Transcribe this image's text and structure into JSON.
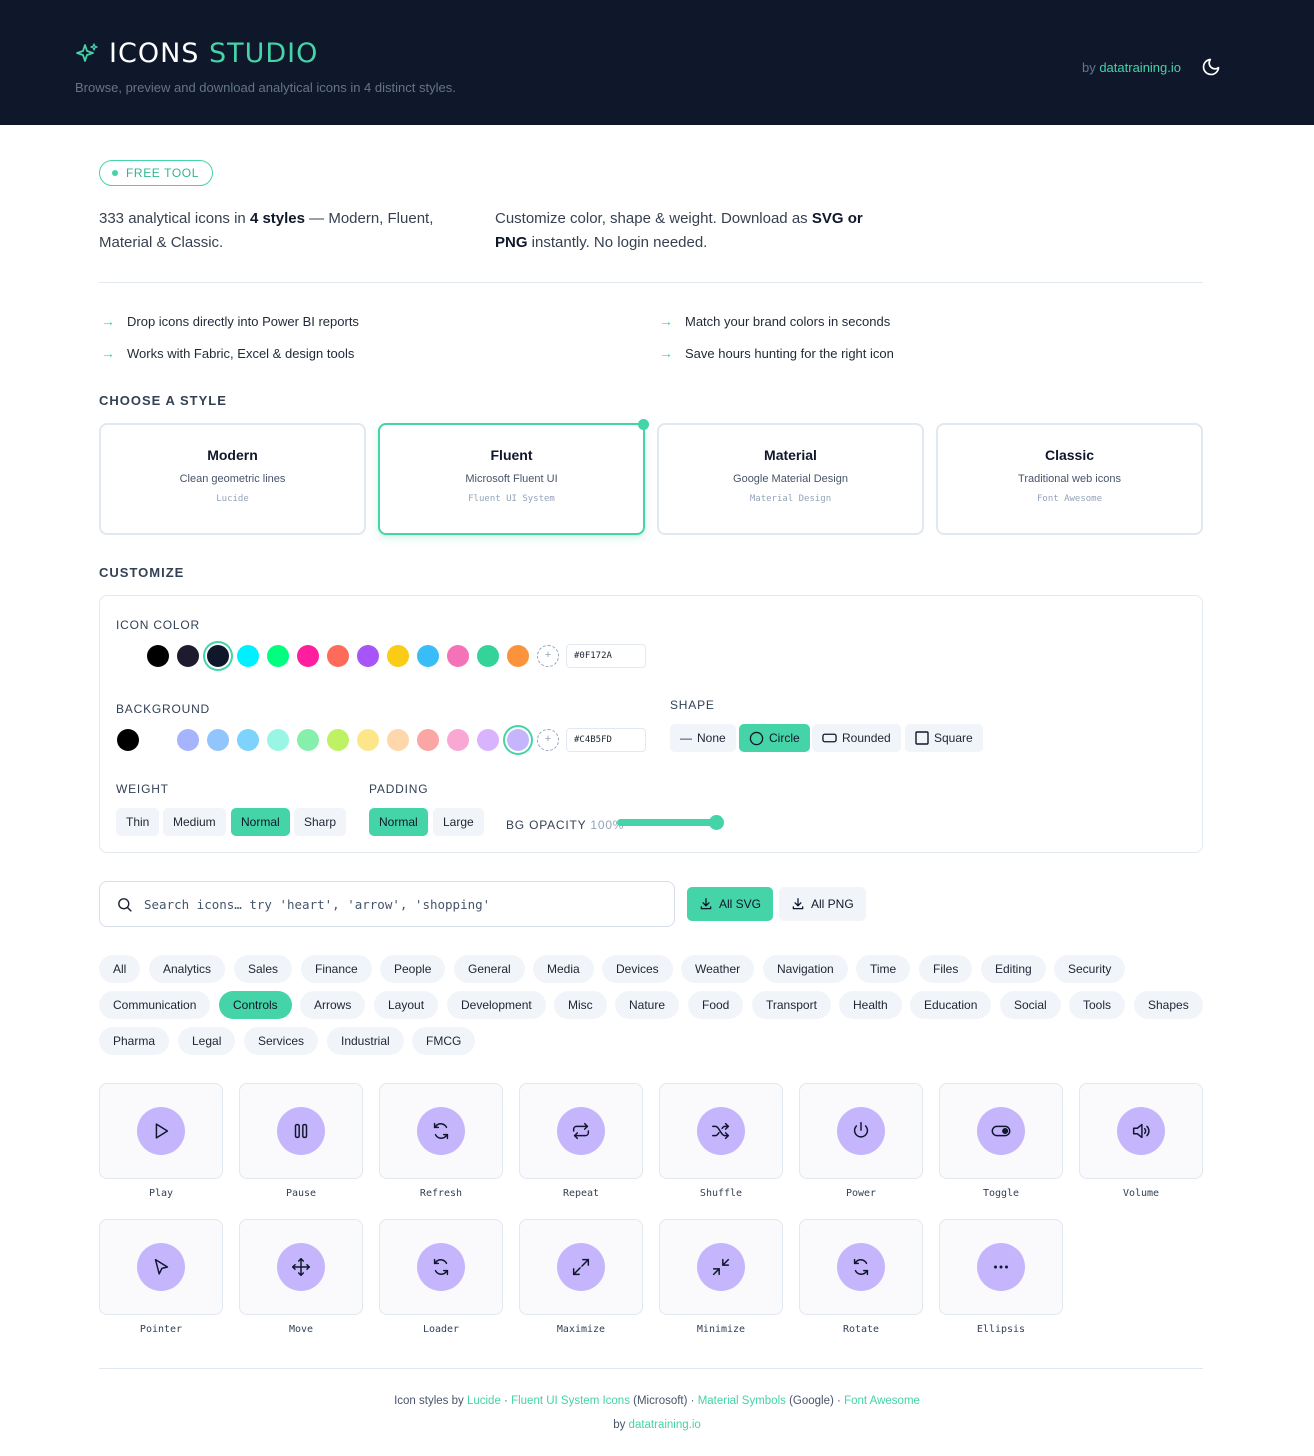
{
  "header": {
    "title_main": "ICONS",
    "title_accent": "STUDIO",
    "subtitle": "Browse, preview and download analytical icons in 4 distinct styles.",
    "by_prefix": "by",
    "by_link": "datatraining.io"
  },
  "badge": "FREE TOOL",
  "intro": {
    "left_a": "333 analytical icons in ",
    "left_b": "4 styles",
    "left_c": " — Modern, Fluent, Material & Classic.",
    "right_a": "Customize color, shape & weight. Download as ",
    "right_b": "SVG or PNG",
    "right_c": " instantly. No login needed."
  },
  "features": [
    "Drop icons directly into Power BI reports",
    "Match your brand colors in seconds",
    "Works with Fabric, Excel & design tools",
    "Save hours hunting for the right icon"
  ],
  "choose_style_label": "CHOOSE A STYLE",
  "styles": [
    {
      "name": "Modern",
      "desc": "Clean geometric lines",
      "lib": "Lucide"
    },
    {
      "name": "Fluent",
      "desc": "Microsoft Fluent UI",
      "lib": "Fluent UI System"
    },
    {
      "name": "Material",
      "desc": "Google Material Design",
      "lib": "Material Design"
    },
    {
      "name": "Classic",
      "desc": "Traditional web icons",
      "lib": "Font Awesome"
    }
  ],
  "selected_style": "Fluent",
  "customize_label": "CUSTOMIZE",
  "customize": {
    "icon_color_label": "ICON COLOR",
    "icon_colors": [
      "#ffffff",
      "#000000",
      "#1e1b2e",
      "#0f172a",
      "#00f0ff",
      "#00ff7f",
      "#ff1f9e",
      "#ff6b5b",
      "#a855f7",
      "#facc15",
      "#38bdf8",
      "#f472b6",
      "#34d399",
      "#fb923c"
    ],
    "icon_color_value": "#0F172A",
    "background_label": "BACKGROUND",
    "bg_colors": [
      "#000000",
      "#ffffff",
      "#a5b4fc",
      "#93c5fd",
      "#7dd3fc",
      "#99f6e4",
      "#86efac",
      "#bef264",
      "#fde68a",
      "#fed7aa",
      "#fca5a5",
      "#f9a8d4",
      "#d8b4fe",
      "#c4b5fd"
    ],
    "bg_color_value": "#C4B5FD",
    "shape_label": "SHAPE",
    "shapes": [
      "None",
      "Circle",
      "Rounded",
      "Square"
    ],
    "shape_selected": "Circle",
    "weight_label": "WEIGHT",
    "weights": [
      "Thin",
      "Medium",
      "Normal",
      "Sharp"
    ],
    "weight_selected": "Normal",
    "padding_label": "PADDING",
    "paddings": [
      "Normal",
      "Large"
    ],
    "padding_selected": "Normal",
    "opacity_label": "BG OPACITY",
    "opacity_value": "100%",
    "opacity_fraction": 1.0
  },
  "search": {
    "placeholder": "Search icons… try 'heart', 'arrow', 'shopping'",
    "all_svg": "All SVG",
    "all_png": "All PNG"
  },
  "categories": [
    "All",
    "Analytics",
    "Sales",
    "Finance",
    "People",
    "General",
    "Media",
    "Devices",
    "Weather",
    "Navigation",
    "Time",
    "Files",
    "Editing",
    "Security",
    "Communication",
    "Controls",
    "Arrows",
    "Layout",
    "Development",
    "Misc",
    "Nature",
    "Food",
    "Transport",
    "Health",
    "Education",
    "Social",
    "Tools",
    "Shapes",
    "Pharma",
    "Legal",
    "Services",
    "Industrial",
    "FMCG"
  ],
  "category_selected": "Controls",
  "icons": [
    {
      "label": "Play",
      "icon": "play-icon"
    },
    {
      "label": "Pause",
      "icon": "pause-icon"
    },
    {
      "label": "Refresh",
      "icon": "refresh-icon"
    },
    {
      "label": "Repeat",
      "icon": "repeat-icon"
    },
    {
      "label": "Shuffle",
      "icon": "shuffle-icon"
    },
    {
      "label": "Power",
      "icon": "power-icon"
    },
    {
      "label": "Toggle",
      "icon": "toggle-icon"
    },
    {
      "label": "Volume",
      "icon": "volume-icon"
    },
    {
      "label": "Pointer",
      "icon": "pointer-icon"
    },
    {
      "label": "Move",
      "icon": "move-icon"
    },
    {
      "label": "Loader",
      "icon": "loader-icon"
    },
    {
      "label": "Maximize",
      "icon": "maximize-icon"
    },
    {
      "label": "Minimize",
      "icon": "minimize-icon"
    },
    {
      "label": "Rotate",
      "icon": "rotate-icon"
    },
    {
      "label": "Ellipsis",
      "icon": "ellipsis-icon"
    }
  ],
  "footer": {
    "prefix": "Icon styles by ",
    "lucide": "Lucide",
    "sep1": " · ",
    "fluent": "Fluent UI System Icons",
    "ms": " (Microsoft) · ",
    "material": "Material Symbols",
    "google": " (Google) · ",
    "fa": "Font Awesome",
    "by_prefix": "by ",
    "by_link": "datatraining.io"
  },
  "colors": {
    "accent": "#45d3a8",
    "header_bg": "#0f172a",
    "tile_icon_bg": "#c4b5fd"
  }
}
